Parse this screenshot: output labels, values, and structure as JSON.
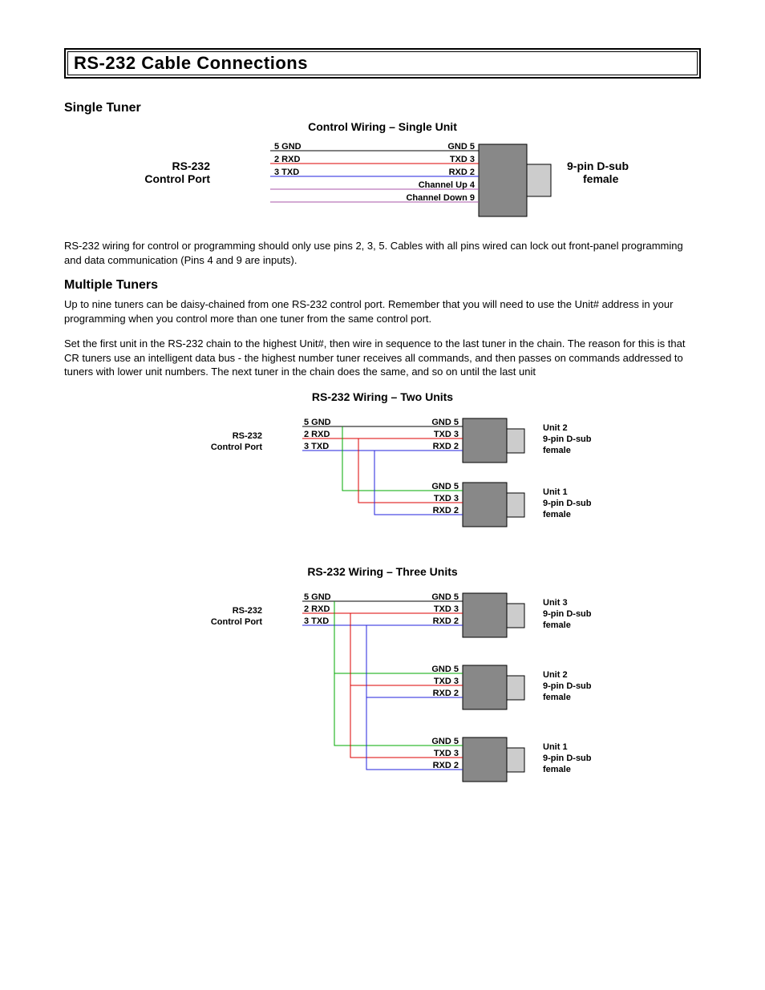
{
  "page_title": "RS-232 Cable Connections",
  "section_single": {
    "heading": "Single Tuner",
    "diagram_title": "Control Wiring – Single Unit",
    "left_label": "RS-232\nControl Port",
    "right_label": "9-pin D-sub\nfemale",
    "left_pins": {
      "gnd": "5  GND",
      "rxd": "2  RXD",
      "txd": "3  TXD"
    },
    "right_pins": {
      "gnd": "GND   5",
      "txd": "TXD   3",
      "rxd": "RXD   2",
      "chup": "Channel Up   4",
      "chdn": "Channel Down   9"
    },
    "paragraph": "RS-232 wiring for control or programming should only use pins 2, 3, 5. Cables with all pins wired can lock out front-panel programming and data communication (Pins 4 and 9 are inputs)."
  },
  "section_multi": {
    "heading": "Multiple Tuners",
    "para1": "Up to nine tuners can be daisy-chained from one RS-232 control port. Remember that you will need to use the Unit# address in your programming when you control more than one tuner from the same control port.",
    "para2": "Set the first unit in the RS-232 chain to the highest Unit#, then wire in sequence to the last tuner in the chain. The reason for this is that CR tuners use an intelligent data bus - the highest number tuner receives all commands, and then passes on commands addressed to tuners with lower unit numbers. The next tuner in the chain does the same, and so on until the last unit",
    "diag2_title": "RS-232 Wiring – Two Units",
    "diag3_title": "RS-232 Wiring – Three Units",
    "left_label": "RS-232\nControl Port",
    "unit_label": {
      "u1": "Unit 1\n9-pin D-sub\nfemale",
      "u2": "Unit 2\n9-pin D-sub\nfemale",
      "u3": "Unit 3\n9-pin D-sub\nfemale"
    },
    "pins": {
      "gnd_l": "5  GND",
      "rxd_l": "2  RXD",
      "txd_l": "3  TXD",
      "gnd_r": "GND   5",
      "txd_r": "TXD   3",
      "rxd_r": "RXD   2"
    }
  }
}
